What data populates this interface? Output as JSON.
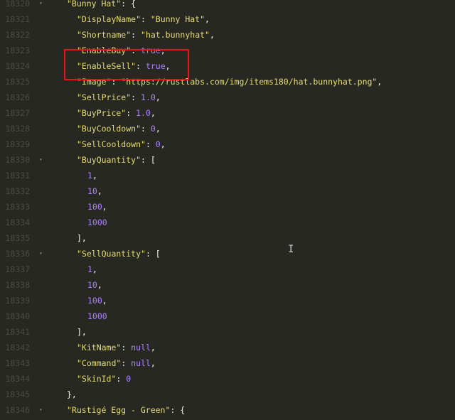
{
  "lines": [
    {
      "n": "18320",
      "fold": "▾",
      "indent": 94,
      "parts": [
        [
          "str",
          "\"Bunny Hat\""
        ],
        [
          "punct",
          ": {"
        ]
      ]
    },
    {
      "n": "18321",
      "fold": "",
      "indent": 108,
      "parts": [
        [
          "str",
          "\"DisplayName\""
        ],
        [
          "punct",
          ": "
        ],
        [
          "str",
          "\"Bunny Hat\""
        ],
        [
          "punct",
          ","
        ]
      ]
    },
    {
      "n": "18322",
      "fold": "",
      "indent": 108,
      "parts": [
        [
          "str",
          "\"Shortname\""
        ],
        [
          "punct",
          ": "
        ],
        [
          "str",
          "\"hat.bunnyhat\""
        ],
        [
          "punct",
          ","
        ]
      ]
    },
    {
      "n": "18323",
      "fold": "",
      "indent": 108,
      "parts": [
        [
          "str",
          "\"EnableBuy\""
        ],
        [
          "punct",
          ": "
        ],
        [
          "kw",
          "true"
        ],
        [
          "punct",
          ","
        ]
      ]
    },
    {
      "n": "18324",
      "fold": "",
      "indent": 108,
      "parts": [
        [
          "str",
          "\"EnableSell\""
        ],
        [
          "punct",
          ": "
        ],
        [
          "kw",
          "true"
        ],
        [
          "punct",
          ","
        ]
      ]
    },
    {
      "n": "18325",
      "fold": "",
      "indent": 108,
      "parts": [
        [
          "str",
          "\"Image\""
        ],
        [
          "punct",
          ": "
        ],
        [
          "str",
          "\"https://rustlabs.com/img/items180/hat.bunnyhat.png\""
        ],
        [
          "punct",
          ","
        ]
      ]
    },
    {
      "n": "18326",
      "fold": "",
      "indent": 108,
      "parts": [
        [
          "str",
          "\"SellPrice\""
        ],
        [
          "punct",
          ": "
        ],
        [
          "num",
          "1.0"
        ],
        [
          "punct",
          ","
        ]
      ]
    },
    {
      "n": "18327",
      "fold": "",
      "indent": 108,
      "parts": [
        [
          "str",
          "\"BuyPrice\""
        ],
        [
          "punct",
          ": "
        ],
        [
          "num",
          "1.0"
        ],
        [
          "punct",
          ","
        ]
      ]
    },
    {
      "n": "18328",
      "fold": "",
      "indent": 108,
      "parts": [
        [
          "str",
          "\"BuyCooldown\""
        ],
        [
          "punct",
          ": "
        ],
        [
          "num",
          "0"
        ],
        [
          "punct",
          ","
        ]
      ]
    },
    {
      "n": "18329",
      "fold": "",
      "indent": 108,
      "parts": [
        [
          "str",
          "\"SellCooldown\""
        ],
        [
          "punct",
          ": "
        ],
        [
          "num",
          "0"
        ],
        [
          "punct",
          ","
        ]
      ]
    },
    {
      "n": "18330",
      "fold": "▾",
      "indent": 108,
      "parts": [
        [
          "str",
          "\"BuyQuantity\""
        ],
        [
          "punct",
          ": ["
        ]
      ]
    },
    {
      "n": "18331",
      "fold": "",
      "indent": 123,
      "parts": [
        [
          "num",
          "1"
        ],
        [
          "punct",
          ","
        ]
      ]
    },
    {
      "n": "18332",
      "fold": "",
      "indent": 123,
      "parts": [
        [
          "num",
          "10"
        ],
        [
          "punct",
          ","
        ]
      ]
    },
    {
      "n": "18333",
      "fold": "",
      "indent": 123,
      "parts": [
        [
          "num",
          "100"
        ],
        [
          "punct",
          ","
        ]
      ]
    },
    {
      "n": "18334",
      "fold": "",
      "indent": 123,
      "parts": [
        [
          "num",
          "1000"
        ]
      ]
    },
    {
      "n": "18335",
      "fold": "",
      "indent": 108,
      "parts": [
        [
          "punct",
          "],"
        ]
      ]
    },
    {
      "n": "18336",
      "fold": "▾",
      "indent": 108,
      "parts": [
        [
          "str",
          "\"SellQuantity\""
        ],
        [
          "punct",
          ": ["
        ]
      ]
    },
    {
      "n": "18337",
      "fold": "",
      "indent": 123,
      "parts": [
        [
          "num",
          "1"
        ],
        [
          "punct",
          ","
        ]
      ]
    },
    {
      "n": "18338",
      "fold": "",
      "indent": 123,
      "parts": [
        [
          "num",
          "10"
        ],
        [
          "punct",
          ","
        ]
      ]
    },
    {
      "n": "18339",
      "fold": "",
      "indent": 123,
      "parts": [
        [
          "num",
          "100"
        ],
        [
          "punct",
          ","
        ]
      ]
    },
    {
      "n": "18340",
      "fold": "",
      "indent": 123,
      "parts": [
        [
          "num",
          "1000"
        ]
      ]
    },
    {
      "n": "18341",
      "fold": "",
      "indent": 108,
      "parts": [
        [
          "punct",
          "],"
        ]
      ]
    },
    {
      "n": "18342",
      "fold": "",
      "indent": 108,
      "parts": [
        [
          "str",
          "\"KitName\""
        ],
        [
          "punct",
          ": "
        ],
        [
          "kw",
          "null"
        ],
        [
          "punct",
          ","
        ]
      ]
    },
    {
      "n": "18343",
      "fold": "",
      "indent": 108,
      "parts": [
        [
          "str",
          "\"Command\""
        ],
        [
          "punct",
          ": "
        ],
        [
          "kw",
          "null"
        ],
        [
          "punct",
          ","
        ]
      ]
    },
    {
      "n": "18344",
      "fold": "",
      "indent": 108,
      "parts": [
        [
          "str",
          "\"SkinId\""
        ],
        [
          "punct",
          ": "
        ],
        [
          "num",
          "0"
        ]
      ]
    },
    {
      "n": "18345",
      "fold": "",
      "indent": 94,
      "parts": [
        [
          "punct",
          "},"
        ]
      ]
    },
    {
      "n": "18346",
      "fold": "▾",
      "indent": 94,
      "parts": [
        [
          "str",
          "\"Rustigé Egg - Green\""
        ],
        [
          "punct",
          ": {"
        ]
      ]
    }
  ],
  "cursor_glyph": "I"
}
